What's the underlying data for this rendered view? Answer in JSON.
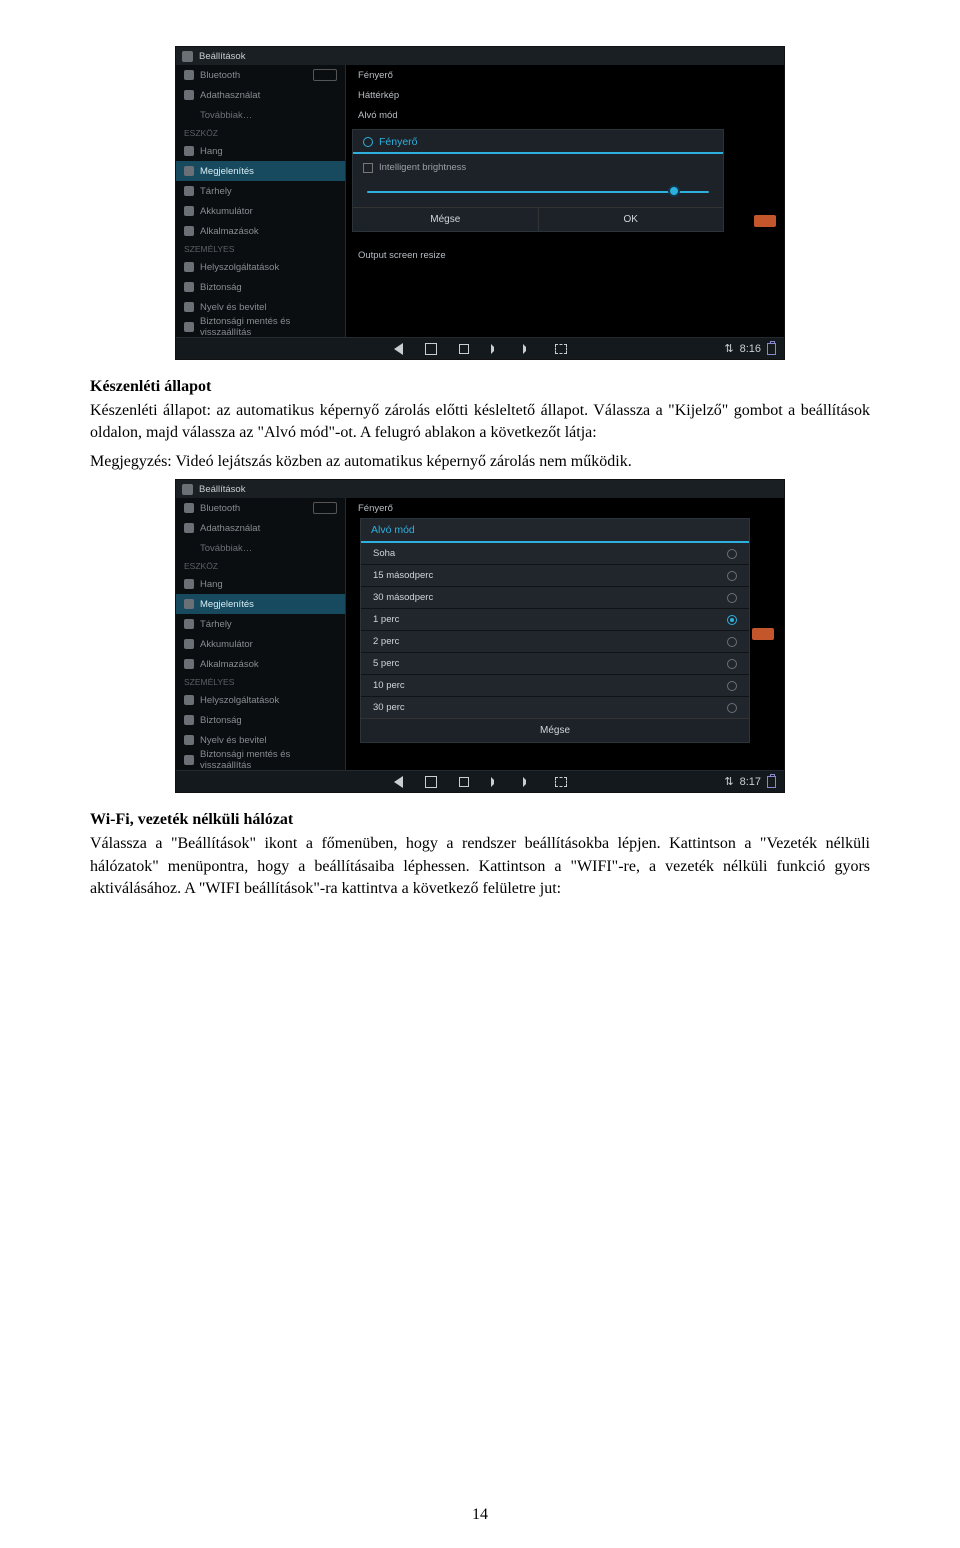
{
  "page_number": "14",
  "doc": {
    "standby_heading": "Készenléti állapot",
    "standby_p1": "Készenléti állapot: az automatikus képernyő zárolás előtti késleltető állapot. Válassza a \"Kijelző\" gombot a beállítások oldalon, majd válassza az \"Alvó mód\"-ot. A felugró ablakon a következőt látja:",
    "standby_p2": "Megjegyzés: Videó lejátszás közben az automatikus képernyő zárolás nem működik.",
    "wifi_heading": "Wi-Fi, vezeték nélküli hálózat",
    "wifi_p1": "Válassza a \"Beállítások\" ikont a főmenüben, hogy a rendszer beállításokba lépjen. Kattintson a \"Vezeték nélküli hálózatok\" menüpontra, hogy a beállításaiba léphessen. Kattintson a \"WIFI\"-re, a vezeték nélküli funkció gyors aktiválásához. A \"WIFI beállítások\"-ra kattintva a következő felületre jut:"
  },
  "ss_common": {
    "app_title": "Beállítások",
    "sections": {
      "device": "ESZKÖZ",
      "personal": "SZEMÉLYES"
    },
    "menu": {
      "bluetooth": "Bluetooth",
      "data": "Adathasználat",
      "more": "Továbbiak…",
      "sound": "Hang",
      "display": "Megjelenítés",
      "storage": "Tárhely",
      "battery": "Akkumulátor",
      "apps": "Alkalmazások",
      "location": "Helyszolgáltatások",
      "security": "Biztonság",
      "lang": "Nyelv és bevitel",
      "backup": "Biztonsági mentés és visszaállítás"
    }
  },
  "ss1": {
    "right_opts": {
      "brightness": "Fényerő",
      "wallpaper": "Háttérkép",
      "sleep": "Alvó mód",
      "output": "Output screen resize"
    },
    "dialog": {
      "title": "Fényerő",
      "checkbox": "Intelligent brightness",
      "cancel": "Mégse",
      "ok": "OK"
    },
    "time": "8:16"
  },
  "ss2": {
    "right_opt_top": "Fényerő",
    "dialog": {
      "title": "Alvó mód",
      "options": [
        {
          "label": "Soha",
          "selected": false
        },
        {
          "label": "15 másodperc",
          "selected": false
        },
        {
          "label": "30 másodperc",
          "selected": false
        },
        {
          "label": "1 perc",
          "selected": true
        },
        {
          "label": "2 perc",
          "selected": false
        },
        {
          "label": "5 perc",
          "selected": false
        },
        {
          "label": "10 perc",
          "selected": false
        },
        {
          "label": "30 perc",
          "selected": false
        }
      ],
      "cancel": "Mégse"
    },
    "time": "8:17"
  }
}
